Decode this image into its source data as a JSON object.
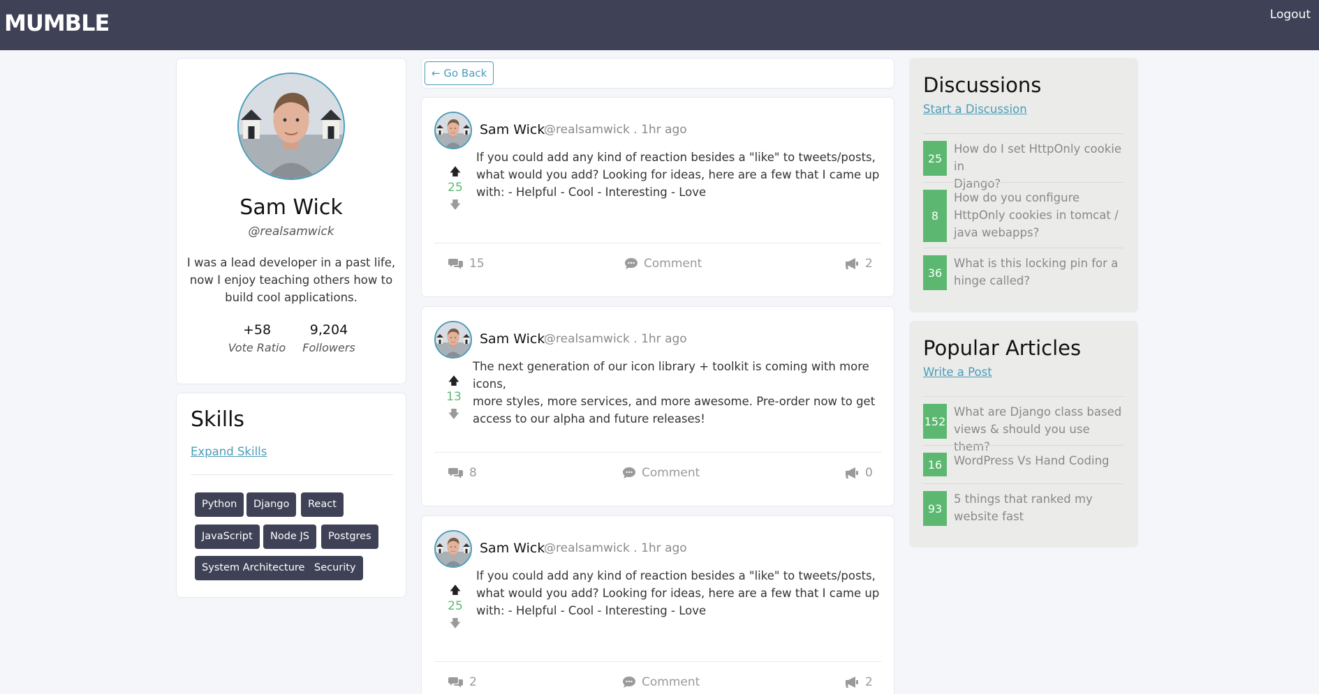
{
  "header": {
    "brand": "MUMBLE",
    "logout": "Logout"
  },
  "profile": {
    "name": "Sam Wick",
    "handle": "@realsamwick",
    "bio_lines": [
      "I was a lead developer in a past life,",
      "now I enjoy teaching others how to",
      "build cool applications."
    ],
    "vote_ratio": "+58",
    "vote_ratio_label": "Vote Ratio",
    "followers": "9,204",
    "followers_label": "Followers"
  },
  "skills": {
    "title": "Skills",
    "expand_label": "Expand Skills",
    "tags": [
      "Python",
      "Django",
      "React",
      "JavaScript",
      "Node JS",
      "Postgres",
      "System Architecture",
      "Security"
    ]
  },
  "feed": {
    "go_back_label": "← Go Back",
    "posts": [
      {
        "author": "Sam Wick",
        "meta": "@realsamwick . 1hr ago",
        "votes": "25",
        "body_lines": [
          "If you could add any kind of reaction besides a \"like\" to tweets/posts,",
          "what would you add? Looking for ideas, here are a few that I came up",
          "with: - Helpful - Cool - Interesting - Love"
        ],
        "comments_count": "15",
        "comment_label": "Comment",
        "shares": "2"
      },
      {
        "author": "Sam Wick",
        "meta": "@realsamwick . 1hr ago",
        "votes": "13",
        "body_lines": [
          "The next generation of our icon library + toolkit is coming with more icons,",
          "more styles, more services, and more awesome. Pre-order now to get",
          "access to our alpha and future releases!"
        ],
        "comments_count": "8",
        "comment_label": "Comment",
        "shares": "0"
      },
      {
        "author": "Sam Wick",
        "meta": "@realsamwick . 1hr ago",
        "votes": "25",
        "body_lines": [
          "If you could add any kind of reaction besides a \"like\" to tweets/posts,",
          "what would you add? Looking for ideas, here are a few that I came up",
          "with: - Helpful - Cool - Interesting - Love"
        ],
        "comments_count": "2",
        "comment_label": "Comment",
        "shares": "2"
      }
    ]
  },
  "discussions": {
    "title": "Discussions",
    "link": "Start a Discussion",
    "items": [
      {
        "count": "25",
        "lines": [
          "How do I set HttpOnly cookie in",
          "Django?"
        ]
      },
      {
        "count": "8",
        "lines": [
          "How do you configure",
          "HttpOnly cookies in tomcat /",
          "java webapps?"
        ]
      },
      {
        "count": "36",
        "lines": [
          "What is this locking pin for a",
          "hinge called?"
        ]
      }
    ]
  },
  "articles": {
    "title": "Popular Articles",
    "link": "Write a Post",
    "items": [
      {
        "count": "152",
        "lines": [
          "What are Django class based",
          "views & should you use them?"
        ]
      },
      {
        "count": "16",
        "lines": [
          "WordPress Vs Hand Coding"
        ]
      },
      {
        "count": "93",
        "lines": [
          "5 things that ranked my",
          "website fast"
        ]
      }
    ]
  },
  "colors": {
    "nav": "#3f4156",
    "accent": "#4a9cb9",
    "vote_green": "#5cb870",
    "tag_bg": "#3f4156"
  }
}
